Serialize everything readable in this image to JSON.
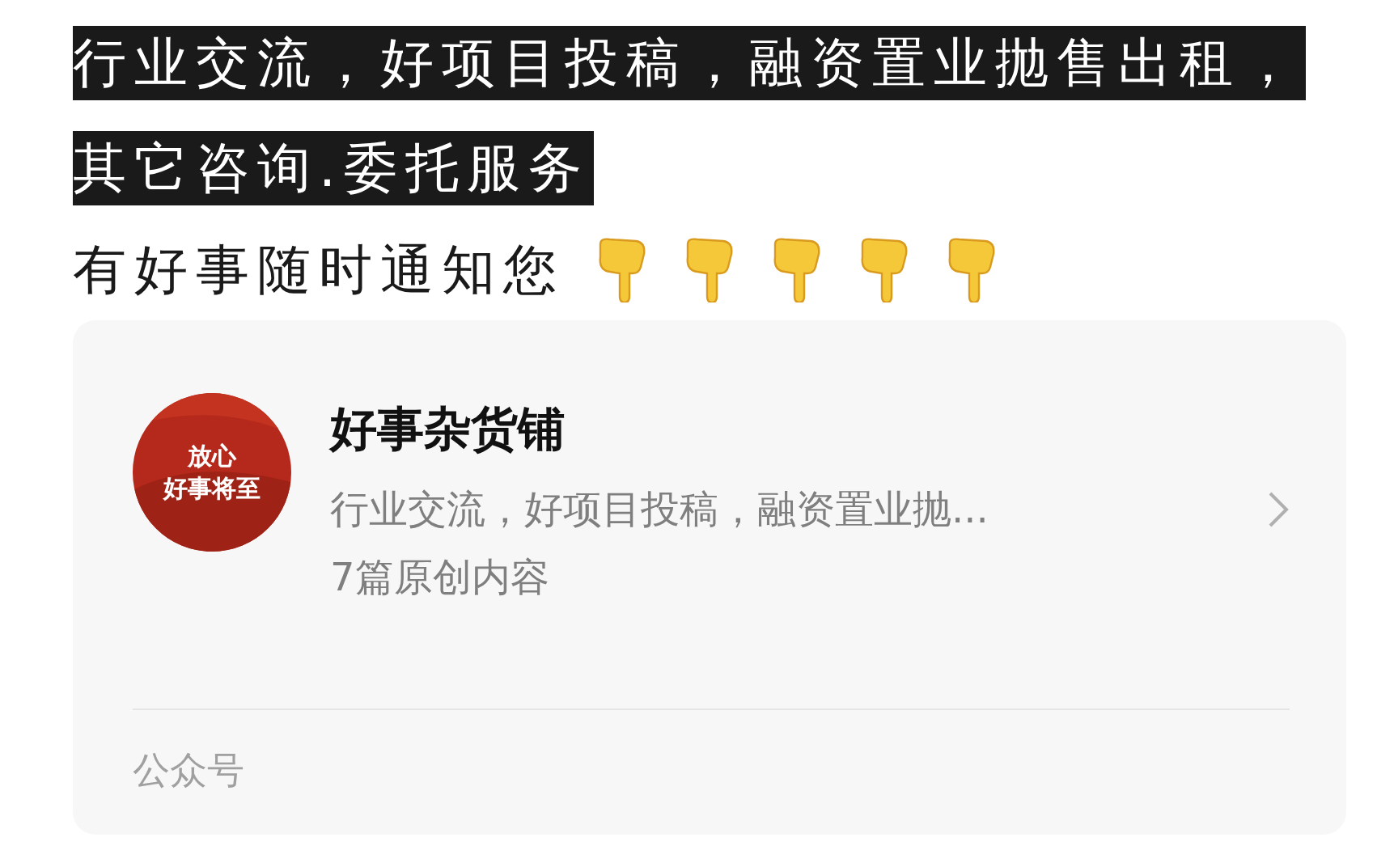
{
  "highlighted_lines": [
    "行业交流，好项目投稿，融资置业抛售出租，",
    "其它咨询.委托服务"
  ],
  "notice": {
    "text": "有好事随时通知您",
    "emojis": [
      {
        "kind": "pointing-down"
      },
      {
        "kind": "pointing-down"
      },
      {
        "kind": "pointing-down"
      },
      {
        "kind": "pointing-down"
      },
      {
        "kind": "pointing-down"
      }
    ]
  },
  "account_card": {
    "avatar_lines": [
      "放心",
      "好事将至"
    ],
    "name": "好事杂货铺",
    "description": "行业交流，好项目投稿，融资置业抛...",
    "article_count": "7篇原创内容",
    "footer": "公众号"
  }
}
